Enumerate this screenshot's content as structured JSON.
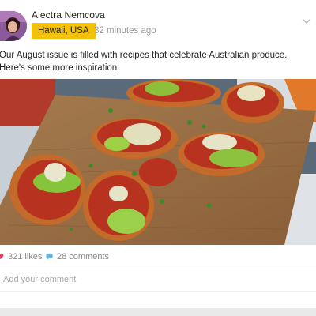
{
  "post": {
    "author": "Alectra Nemcova",
    "location": "Hawaii, USA",
    "timestamp": "32 minutes ago",
    "text": "Our August issue is filled with recipes that celebrate Australian produce. Here's some more inspiration.",
    "image_subject": "bruschetta with avocado, tomato and artichoke on a wooden board",
    "likes": "321 likes",
    "comments": "28 comments"
  },
  "comment_box": {
    "placeholder": "Add your comment"
  },
  "icons": {
    "menu": "chevron-down-icon",
    "like": "heart-icon",
    "comment": "comment-icon"
  },
  "colors": {
    "location_badge": "#f3c10a",
    "like_heart": "#e0445a",
    "comment_icon": "#5bb7e0"
  }
}
